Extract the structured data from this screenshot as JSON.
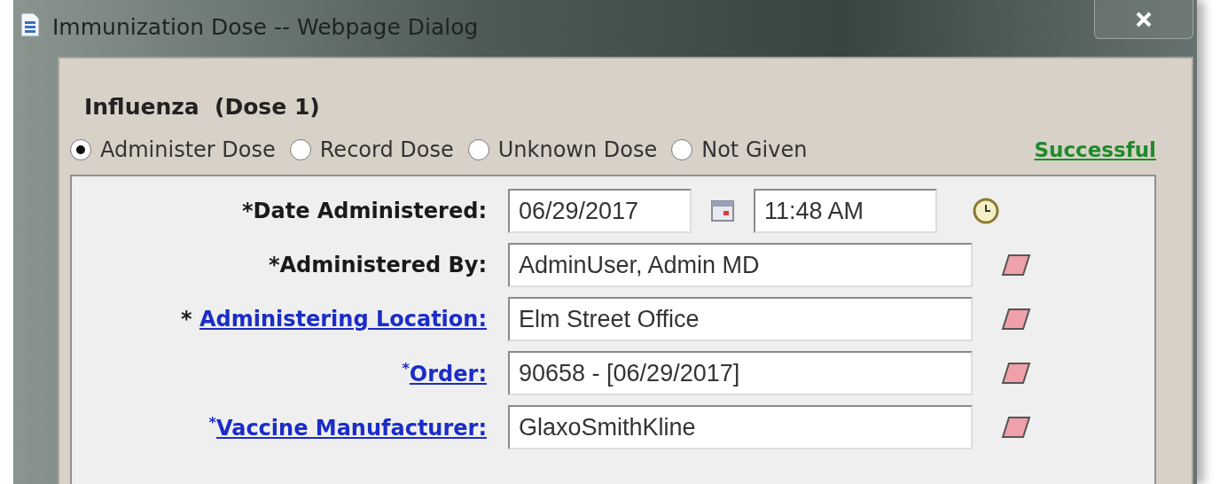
{
  "window": {
    "title": "Immunization Dose -- Webpage Dialog"
  },
  "heading": "Influenza  (Dose 1)",
  "dose_options": [
    {
      "label": "Administer Dose",
      "selected": true
    },
    {
      "label": "Record Dose",
      "selected": false
    },
    {
      "label": "Unknown Dose",
      "selected": false
    },
    {
      "label": "Not Given",
      "selected": false
    }
  ],
  "status": "Successful",
  "fields": [
    {
      "kind": "datetime",
      "asterisk": "*",
      "raised": false,
      "link": false,
      "label": "Date Administered:",
      "value": "06/29/2017",
      "time": "11:48 AM"
    },
    {
      "kind": "text",
      "asterisk": "*",
      "raised": false,
      "link": false,
      "label": "Administered By:",
      "value": "AdminUser, Admin MD"
    },
    {
      "kind": "text",
      "asterisk": "* ",
      "raised": false,
      "link": true,
      "label": "Administering Location:",
      "value": "Elm Street Office"
    },
    {
      "kind": "text",
      "asterisk": "*",
      "raised": true,
      "link": true,
      "label": "Order:",
      "value": "90658 - [06/29/2017]"
    },
    {
      "kind": "text",
      "asterisk": "*",
      "raised": true,
      "link": true,
      "label": "Vaccine Manufacturer:",
      "value": "GlaxoSmithKline"
    }
  ]
}
